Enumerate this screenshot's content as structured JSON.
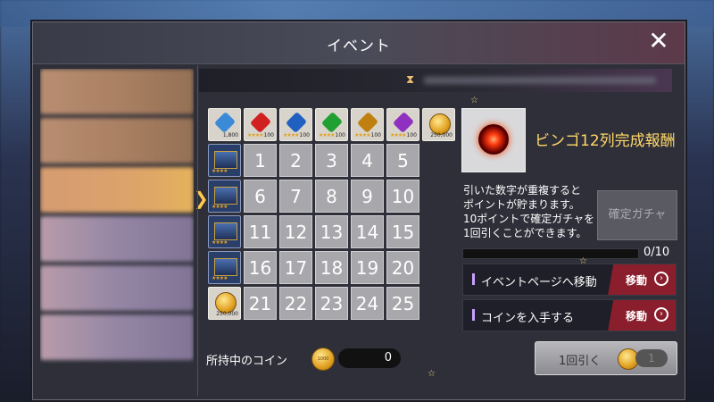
{
  "modal": {
    "title": "イベント",
    "close_label": "✕"
  },
  "bingo": {
    "header_items": [
      {
        "kind": "gem",
        "color": "#3a8ad8",
        "amount": "1,800",
        "stars": ""
      },
      {
        "kind": "gem",
        "color": "#d02020",
        "amount": "100",
        "stars": "★★★★"
      },
      {
        "kind": "gem",
        "color": "#2060c0",
        "amount": "100",
        "stars": "★★★★"
      },
      {
        "kind": "gem",
        "color": "#20a030",
        "amount": "100",
        "stars": "★★★★"
      },
      {
        "kind": "gem",
        "color": "#c08010",
        "amount": "100",
        "stars": "★★★★"
      },
      {
        "kind": "gem",
        "color": "#9030c0",
        "amount": "100",
        "stars": "★★★★"
      },
      {
        "kind": "coin",
        "amount": "250,000"
      }
    ],
    "row_items": [
      {
        "kind": "ticket",
        "stars": "★★★★"
      },
      {
        "kind": "ticket",
        "stars": "★★★★"
      },
      {
        "kind": "ticket",
        "stars": "★★★★"
      },
      {
        "kind": "ticket",
        "stars": "★★★★"
      },
      {
        "kind": "coin",
        "amount": "250,000"
      }
    ],
    "numbers": [
      [
        1,
        2,
        3,
        4,
        5
      ],
      [
        6,
        7,
        8,
        9,
        10
      ],
      [
        11,
        12,
        13,
        14,
        15
      ],
      [
        16,
        17,
        18,
        19,
        20
      ],
      [
        21,
        22,
        23,
        24,
        25
      ]
    ]
  },
  "reward": {
    "title": "ビンゴ12列完成報酬"
  },
  "description": [
    "引いた数字が重複すると",
    "ポイントが貯まります。",
    "10ポイントで確定ガチャを",
    "1回引くことができます。"
  ],
  "confirm_button": "確定ガチャ",
  "progress": {
    "text": "0/10",
    "value": 0,
    "max": 10
  },
  "links": [
    {
      "label": "イベントページへ移動",
      "action": "移動"
    },
    {
      "label": "コインを入手する",
      "action": "移動"
    }
  ],
  "coins": {
    "label": "所持中のコイン",
    "count": "0",
    "icon_text": "1000"
  },
  "pull_button": {
    "label": "1回引く",
    "cost": "1"
  },
  "colors": {
    "accent_gold": "#ffd86a",
    "action_red": "#8a1e2c",
    "number_cell": "#a8a8ac"
  }
}
